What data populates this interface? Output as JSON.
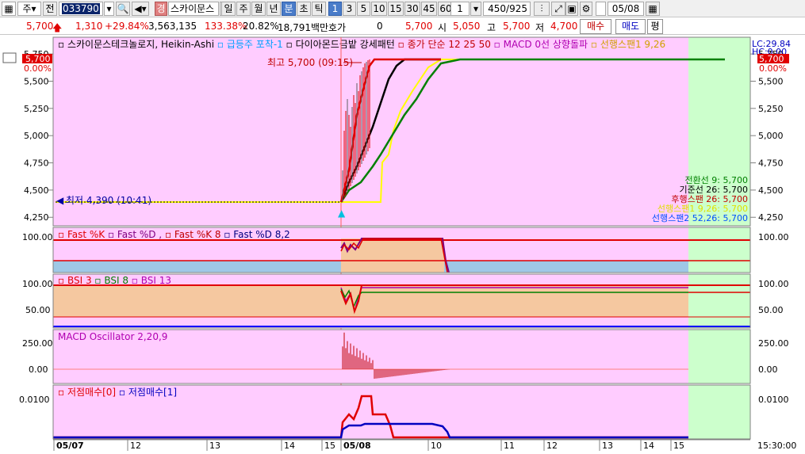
{
  "toolbar": {
    "market": "주",
    "prev_label": "전",
    "code": "033790",
    "search_icon": "search-icon",
    "sound_icon": "speaker-icon",
    "warn_badge": "경",
    "stock_name": "스카이문스",
    "periods": [
      "일",
      "주",
      "월",
      "년",
      "분",
      "초",
      "틱"
    ],
    "active_period": "분",
    "intervals": [
      "1",
      "3",
      "5",
      "10",
      "15",
      "30",
      "45",
      "60"
    ],
    "active_interval": "1",
    "count_value": "1",
    "range_text": "450/925",
    "date_value": "05/08"
  },
  "summary": {
    "price": "5,700",
    "change": "1,310",
    "change_pct": "+29.84%",
    "volume": "3,563,135",
    "vol_ratio": "133.38%",
    "turnover": "20.82%",
    "amount": "18,791백만",
    "hoga_label": "호가",
    "hoga_value": "0",
    "hoga_price": "5,700",
    "open_label": "시",
    "open_value": "5,050",
    "high_label": "고",
    "high_value": "5,700",
    "low_label": "저",
    "low_value": "4,700",
    "buy_button": "매수",
    "sell_button": "매도",
    "eval_button": "평"
  },
  "main_chart": {
    "legend": [
      "스카이문스테크놀로지, Heikin-Ashi",
      "급등주 포착-1",
      "다이아몬드금밭 강세패턴",
      "종가 단순 12 25 50",
      "MACD 0선 상향돌파",
      "선행스팬1 9,26"
    ],
    "legend_colors": [
      "#000000",
      "#00a0ff",
      "#000000",
      "#c00000",
      "#b000b0",
      "#d0a000"
    ],
    "right_top": [
      "LC:29.84",
      "HC:0.00"
    ],
    "price_tag": "5,700",
    "pct_tag": "0.00%",
    "y_ticks": [
      "5,750",
      "5,500",
      "5,250",
      "5,000",
      "4,750",
      "4,500",
      "4,250"
    ],
    "y_values": [
      5750,
      5500,
      5250,
      5000,
      4750,
      4500,
      4250
    ],
    "high_label": "최고 5,700 (09:15)",
    "low_label": "최저 4,390 (10:41)",
    "ichimoku": [
      {
        "text": "전환선 9: 5,700",
        "color": "#008000"
      },
      {
        "text": "기준선 26: 5,700",
        "color": "#000000"
      },
      {
        "text": "후행스팬 26: 5,700",
        "color": "#c00000"
      },
      {
        "text": "선행스팬1 9,26: 5,700",
        "color": "#e0e000"
      },
      {
        "text": "선행스팬2 52,26: 5,700",
        "color": "#0050ff"
      }
    ]
  },
  "stoch": {
    "legend": [
      "Fast %K",
      "Fast %D ,",
      "Fast %K 8",
      "Fast %D 8,2"
    ],
    "legend_colors": [
      "#e00000",
      "#800080",
      "#c00000",
      "#000080"
    ],
    "y_tick": "100.00"
  },
  "bsi": {
    "legend": [
      "BSI 3",
      "BSI 8",
      "BSI 13"
    ],
    "legend_colors": [
      "#e00000",
      "#008000",
      "#b000b0"
    ],
    "y_ticks": [
      "100.00",
      "50.00"
    ]
  },
  "macd": {
    "legend": "MACD Oscillator 2,20,9",
    "legend_color": "#b000b0",
    "y_ticks": [
      "250.00",
      "0.00"
    ]
  },
  "low_buy": {
    "legend": [
      "저점매수[0]",
      "저점매수[1]"
    ],
    "legend_colors": [
      "#e00000",
      "#0000c0"
    ],
    "y_tick": "0.0100"
  },
  "x_axis": {
    "labels": [
      "05/07",
      "12",
      "13",
      "14",
      "15",
      "05/08",
      "10",
      "11",
      "12",
      "13",
      "14",
      "15"
    ],
    "time_label": "15:30:00"
  },
  "colors": {
    "pink_bg": "#ffccff",
    "green_bg": "#ccffcc",
    "peach": "#f5c8a0",
    "blue_band": "#9fc8e6"
  }
}
